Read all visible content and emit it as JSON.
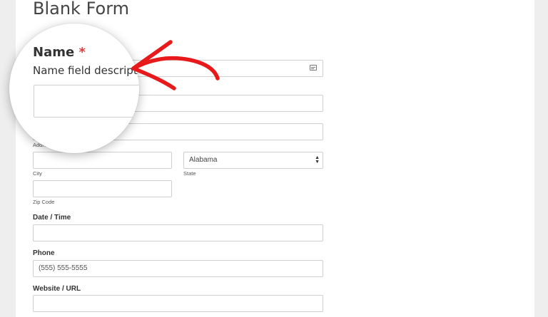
{
  "form": {
    "title": "Blank Form"
  },
  "name_field": {
    "label": "Name",
    "required_marker": "*",
    "description": "Name field descript"
  },
  "address": {
    "line2_sublabel": "Address Line 2",
    "city_sublabel": "City",
    "state_sublabel": "State",
    "state_value": "Alabama",
    "zip_sublabel": "Zip Code"
  },
  "date_time": {
    "label": "Date / Time"
  },
  "phone": {
    "label": "Phone",
    "placeholder": "(555) 555-5555"
  },
  "website": {
    "label": "Website / URL"
  },
  "annotation": {
    "arrow_color": "#e8191a"
  },
  "icons": {
    "field_icon": "credit-card-icon",
    "select_icon": "select-arrows-icon"
  }
}
